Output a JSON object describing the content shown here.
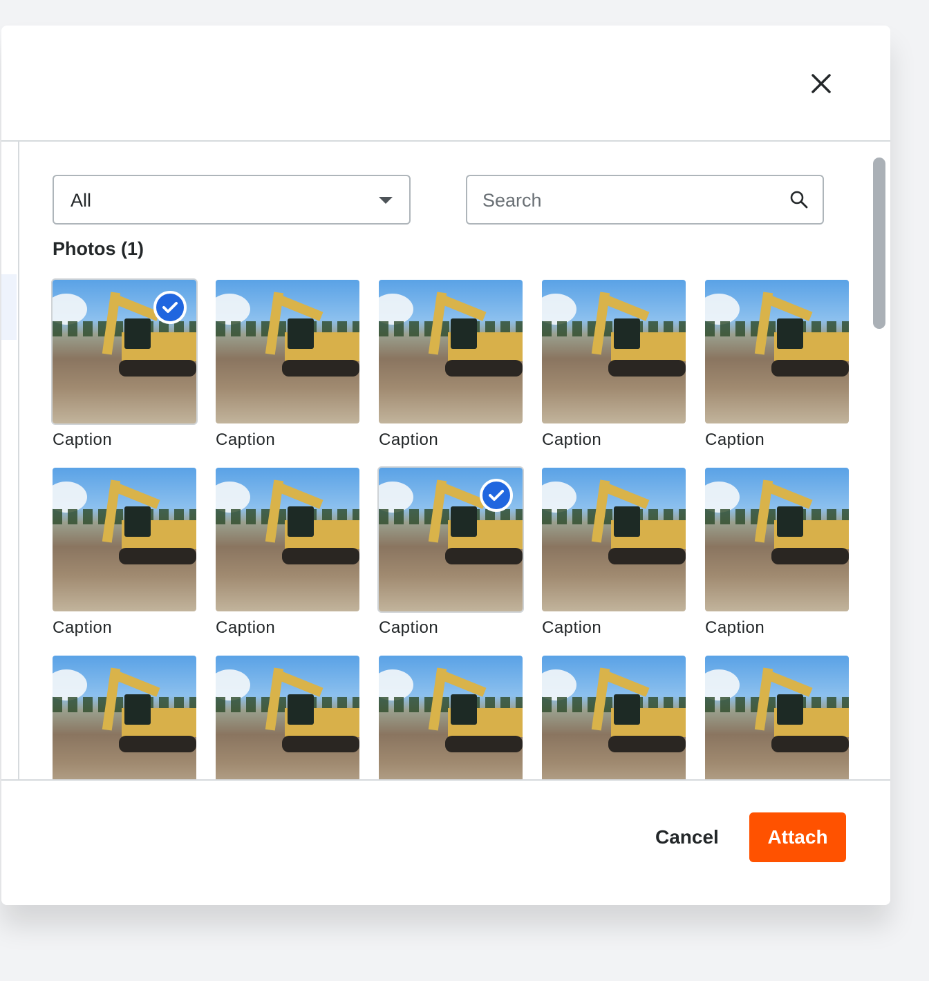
{
  "filter": {
    "selected": "All"
  },
  "search": {
    "placeholder": "Search"
  },
  "section_title": "Photos (1)",
  "photos": [
    {
      "caption": "Caption",
      "selected": true
    },
    {
      "caption": "Caption",
      "selected": false
    },
    {
      "caption": "Caption",
      "selected": false
    },
    {
      "caption": "Caption",
      "selected": false
    },
    {
      "caption": "Caption",
      "selected": false
    },
    {
      "caption": "Caption",
      "selected": false
    },
    {
      "caption": "Caption",
      "selected": false
    },
    {
      "caption": "Caption",
      "selected": true
    },
    {
      "caption": "Caption",
      "selected": false
    },
    {
      "caption": "Caption",
      "selected": false
    },
    {
      "caption": "",
      "selected": false
    },
    {
      "caption": "",
      "selected": false
    },
    {
      "caption": "",
      "selected": false
    },
    {
      "caption": "",
      "selected": false
    },
    {
      "caption": "",
      "selected": false
    }
  ],
  "footer": {
    "cancel_label": "Cancel",
    "attach_label": "Attach"
  },
  "colors": {
    "accent": "#ff5200",
    "check": "#2066df"
  }
}
